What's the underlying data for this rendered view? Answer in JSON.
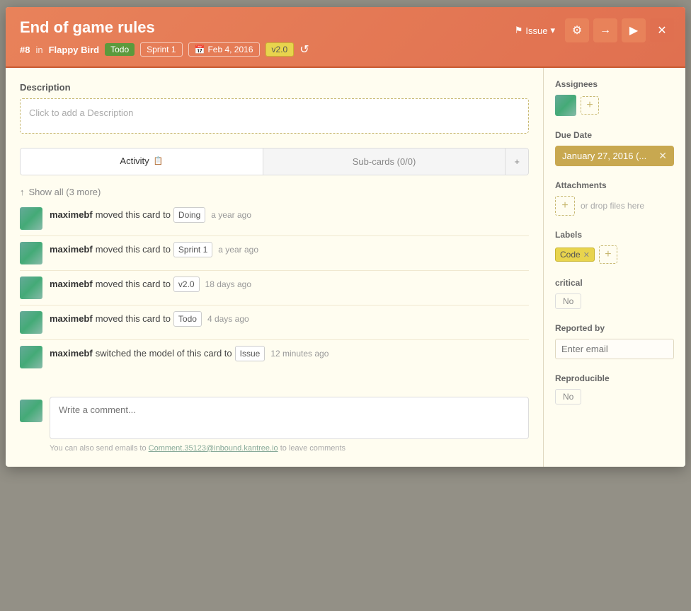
{
  "header": {
    "title": "End of game rules",
    "id": "#8",
    "in_label": "in",
    "project": "Flappy Bird",
    "badges": {
      "todo": "Todo",
      "sprint": "Sprint 1",
      "date": "Feb 4, 2016",
      "version": "v2.0"
    },
    "issue_btn": "Issue",
    "gear_icon": "⚙",
    "arrow_icon": "→",
    "play_icon": "▶",
    "close_icon": "✕"
  },
  "description": {
    "label": "Description",
    "placeholder": "Click to add a Description"
  },
  "tabs": {
    "activity_label": "Activity",
    "subcards_label": "Sub-cards (0/0)"
  },
  "activity": {
    "show_all_label": "Show all (3 more)",
    "items": [
      {
        "user": "maximebf",
        "action": "moved this card to",
        "destination": "Doing",
        "time": "a year ago"
      },
      {
        "user": "maximebf",
        "action": "moved this card to",
        "destination": "Sprint 1",
        "time": "a year ago"
      },
      {
        "user": "maximebf",
        "action": "moved this card to",
        "destination": "v2.0",
        "time": "18 days ago"
      },
      {
        "user": "maximebf",
        "action": "moved this card to",
        "destination": "Todo",
        "time": "4 days ago"
      },
      {
        "user": "maximebf",
        "action": "switched the model of this card to",
        "destination": "Issue",
        "time": "12 minutes ago"
      }
    ]
  },
  "comment": {
    "placeholder": "Write a comment...",
    "hint_prefix": "You can also send emails to",
    "hint_email": "Comment.35123@inbound.kantree.io",
    "hint_suffix": "to leave comments"
  },
  "sidebar": {
    "assignees_label": "Assignees",
    "due_date_label": "Due Date",
    "due_date_value": "January 27, 2016  (...",
    "attachments_label": "Attachments",
    "drop_label": "or drop files here",
    "labels_label": "Labels",
    "code_label": "Code",
    "critical_label": "critical",
    "no_label": "No",
    "reported_label": "Reported by",
    "email_placeholder": "Enter email",
    "reproducible_label": "Reproducible",
    "no_label2": "No"
  }
}
